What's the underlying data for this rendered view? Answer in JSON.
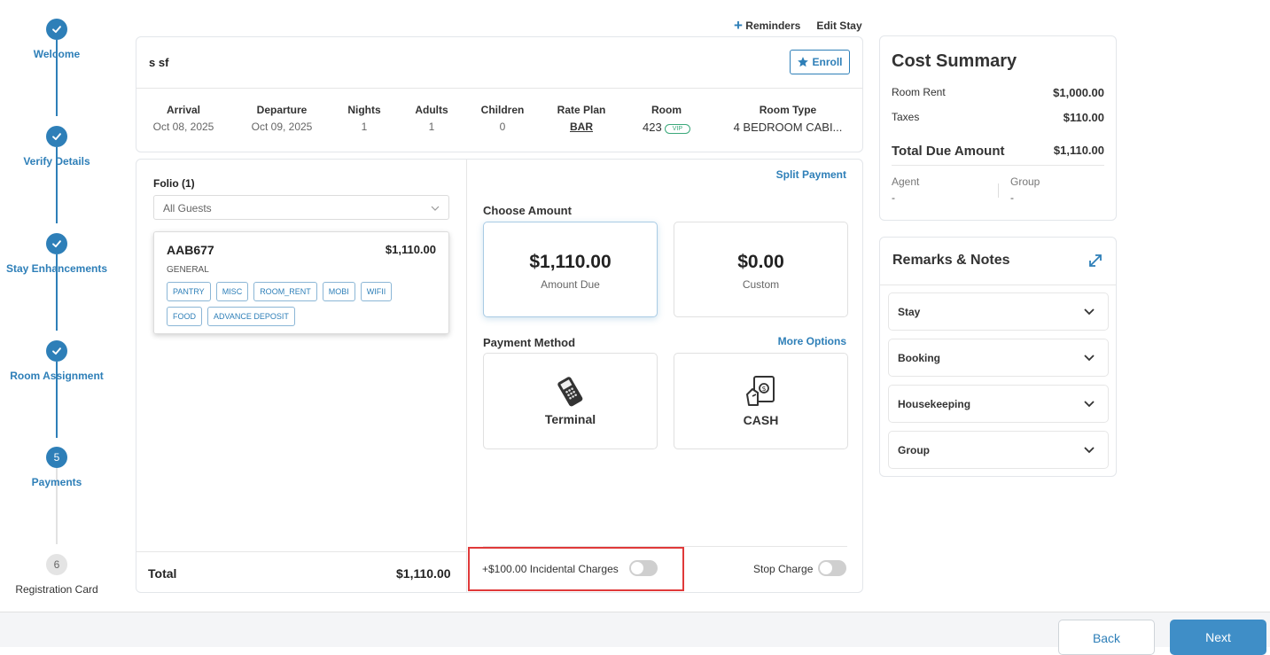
{
  "stepper": {
    "steps": [
      {
        "label": "Welcome",
        "state": "done"
      },
      {
        "label": "Verify Details",
        "state": "done"
      },
      {
        "label": "Stay Enhancements",
        "state": "done"
      },
      {
        "label": "Room Assignment",
        "state": "done"
      },
      {
        "label": "Payments",
        "state": "active",
        "number": "5"
      },
      {
        "label": "Registration Card",
        "state": "todo",
        "number": "6"
      }
    ]
  },
  "top_links": {
    "reminders": "Reminders",
    "edit_stay": "Edit Stay"
  },
  "guest": {
    "name": "s sf",
    "enroll_label": "Enroll",
    "stay": {
      "arrival_label": "Arrival",
      "arrival": "Oct 08, 2025",
      "departure_label": "Departure",
      "departure": "Oct 09, 2025",
      "nights_label": "Nights",
      "nights": "1",
      "adults_label": "Adults",
      "adults": "1",
      "children_label": "Children",
      "children": "0",
      "rate_plan_label": "Rate Plan",
      "rate_plan": "BAR",
      "room_label": "Room",
      "room": "423",
      "room_badge": "VIP",
      "room_type_label": "Room Type",
      "room_type": "4 BEDROOM CABI..."
    }
  },
  "folio": {
    "title": "Folio (1)",
    "guest_filter": "All Guests",
    "id": "AAB677",
    "amount": "$1,110.00",
    "category": "GENERAL",
    "tags": [
      "PANTRY",
      "MISC",
      "ROOM_RENT",
      "MOBI",
      "WIFII",
      "FOOD",
      "ADVANCE DEPOSIT"
    ],
    "total_label": "Total",
    "total_value": "$1,110.00"
  },
  "payment": {
    "split_payment": "Split Payment",
    "choose_amount": "Choose Amount",
    "amount_due_value": "$1,110.00",
    "amount_due_label": "Amount Due",
    "custom_value": "$0.00",
    "custom_label": "Custom",
    "payment_method": "Payment Method",
    "more_options": "More Options",
    "terminal_label": "Terminal",
    "cash_label": "CASH",
    "incidental_label": "+$100.00 Incidental Charges",
    "stop_charge_label": "Stop Charge"
  },
  "cost_summary": {
    "title": "Cost Summary",
    "room_rent_label": "Room Rent",
    "room_rent": "$1,000.00",
    "taxes_label": "Taxes",
    "taxes": "$110.00",
    "total_label": "Total Due Amount",
    "total": "$1,110.00",
    "agent_label": "Agent",
    "agent": "-",
    "group_label": "Group",
    "group": "-"
  },
  "remarks": {
    "title": "Remarks & Notes",
    "sections": [
      "Stay",
      "Booking",
      "Housekeeping",
      "Group"
    ]
  },
  "footer": {
    "back": "Back",
    "next": "Next"
  },
  "colors": {
    "accent": "#2e7fb8",
    "highlight": "#e03a3a",
    "vip": "#3aa87a"
  }
}
